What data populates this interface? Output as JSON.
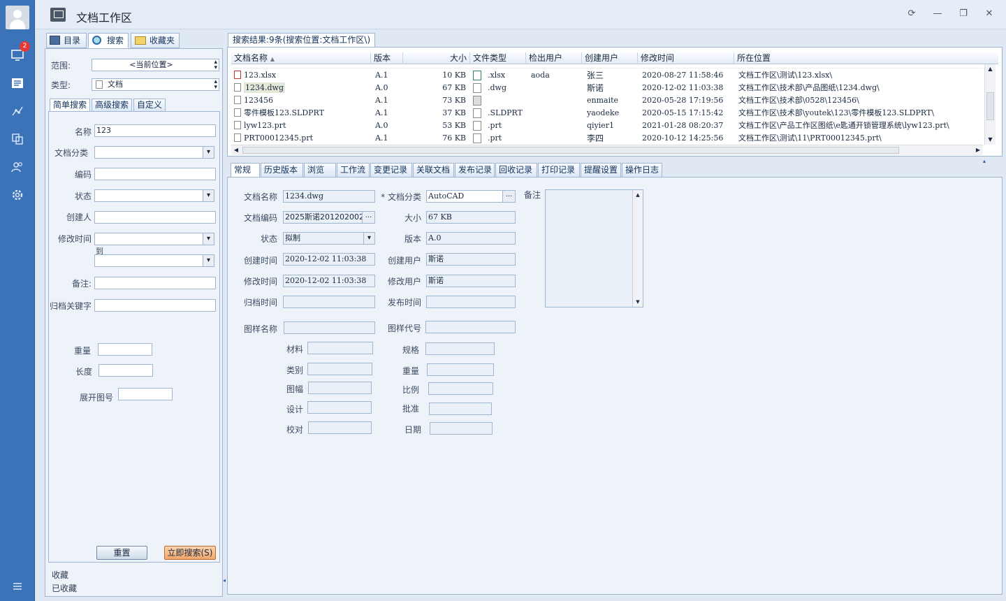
{
  "window": {
    "title": "文档工作区"
  },
  "nav": {
    "badge": "2"
  },
  "left_tabs": [
    "目录",
    "搜索",
    "收藏夹"
  ],
  "search": {
    "scope_label": "范围:",
    "scope_value": "<当前位置>",
    "type_label": "类型:",
    "type_value": "文档",
    "mode_tabs": [
      "简单搜索",
      "高级搜索",
      "自定义"
    ],
    "fields": {
      "name_label": "名称",
      "name_value": "123",
      "category_label": "文档分类",
      "code_label": "编码",
      "status_label": "状态",
      "creator_label": "创建人",
      "modtime_label": "修改时间",
      "to_label": "到",
      "remark_label": "备注:",
      "archive_kw_label": "归档关键字",
      "weight_label": "重量",
      "length_label": "长度",
      "unfold_label": "展开图号"
    },
    "reset_label": "重置",
    "search_label": "立即搜索(S)"
  },
  "favorites": [
    "收藏",
    "已收藏"
  ],
  "results": {
    "tab_label": "搜索结果:9条(搜索位置:文档工作区\\)",
    "columns": [
      "文档名称",
      "版本",
      "大小",
      "文件类型",
      "检出用户",
      "创建用户",
      "修改时间",
      "所在位置"
    ],
    "rows": [
      {
        "name": "123.xlsx",
        "ver": "A.1",
        "size": "10 KB",
        "type": ".xlsx",
        "checkout": "aoda",
        "creator": "张三",
        "time": "2020-08-27 11:58:46",
        "path": "文档工作区\\测试\\123.xlsx\\"
      },
      {
        "name": "1234.dwg",
        "ver": "A.0",
        "size": "67 KB",
        "type": ".dwg",
        "checkout": "",
        "creator": "斯诺",
        "time": "2020-12-02 11:03:38",
        "path": "文档工作区\\技术部\\产品图纸\\1234.dwg\\"
      },
      {
        "name": "123456",
        "ver": "A.1",
        "size": "73 KB",
        "type": "",
        "checkout": "",
        "creator": "enmaite",
        "time": "2020-05-28 17:19:56",
        "path": "文档工作区\\技术部\\0528\\123456\\"
      },
      {
        "name": "零件模板123.SLDPRT",
        "ver": "A.1",
        "size": "37 KB",
        "type": ".SLDPRT",
        "checkout": "",
        "creator": "yaodeke",
        "time": "2020-05-15 17:15:42",
        "path": "文档工作区\\技术部\\youtek\\123\\零件模板123.SLDPRT\\"
      },
      {
        "name": "lyw123.prt",
        "ver": "A.0",
        "size": "53 KB",
        "type": ".prt",
        "checkout": "",
        "creator": "qiyier1",
        "time": "2021-01-28 08:20:37",
        "path": "文档工作区\\产品工作区图纸\\e匙通开锁管理系统\\lyw123.prt\\"
      },
      {
        "name": "PRT00012345.prt",
        "ver": "A.1",
        "size": "76 KB",
        "type": ".prt",
        "checkout": "",
        "creator": "李四",
        "time": "2020-10-12 14:25:56",
        "path": "文档工作区\\测试\\11\\PRT00012345.prt\\"
      }
    ]
  },
  "detail": {
    "tabs": [
      "常规",
      "历史版本",
      "浏览",
      "工作流",
      "变更记录",
      "关联文档",
      "发布记录",
      "回收记录",
      "打印记录",
      "提醒设置",
      "操作日志"
    ],
    "labels": {
      "doc_name": "文档名称",
      "doc_cat": "* 文档分类",
      "remark": "备注",
      "doc_code": "文档编码",
      "size": "大小",
      "status": "状态",
      "version": "版本",
      "ctime": "创建时间",
      "cuser": "创建用户",
      "mtime": "修改时间",
      "muser": "修改用户",
      "atime": "归档时间",
      "ptime": "发布时间",
      "dname": "图样名称",
      "dcode": "图样代号",
      "material": "材料",
      "spec": "规格",
      "category": "类别",
      "weight": "重量",
      "frame": "图幅",
      "scale": "比例",
      "design": "设计",
      "approve": "批准",
      "check": "校对",
      "date": "日期"
    },
    "values": {
      "doc_name": "1234.dwg",
      "doc_cat": "AutoCAD",
      "doc_code": "2025斯诺201202002",
      "size": "67 KB",
      "status": "拟制",
      "version": "A.0",
      "ctime": "2020-12-02 11:03:38",
      "cuser": "斯诺",
      "mtime": "2020-12-02 11:03:38",
      "muser": "斯诺"
    }
  },
  "colors": {
    "nav": "#3b73b8",
    "accent_button": "#f2a76a",
    "border": "#9fb6d3"
  }
}
